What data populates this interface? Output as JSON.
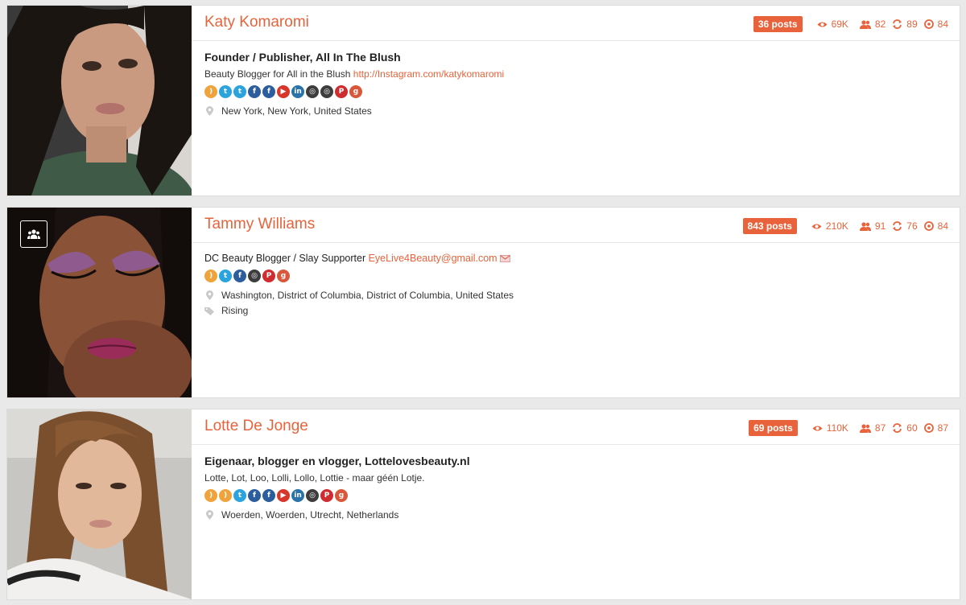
{
  "profiles": [
    {
      "name": "Katy Komaromi",
      "posts": "36 posts",
      "views": "69K",
      "followers": "82",
      "shares": "89",
      "score": "84",
      "title": "Founder / Publisher, All In The Blush",
      "bio": "Beauty Blogger for All in the Blush ",
      "bio_link": "http://Instagram.com/katykomaromi",
      "location": "New York, New York, United States",
      "socials": [
        "rss-icon",
        "twitter-icon",
        "twitter-icon",
        "facebook-icon",
        "facebook-icon",
        "youtube-icon",
        "linkedin-icon",
        "instagram-icon",
        "instagram-icon",
        "pinterest-icon",
        "google-plus-icon"
      ]
    },
    {
      "name": "Tammy Williams",
      "posts": "843 posts",
      "views": "210K",
      "followers": "91",
      "shares": "76",
      "score": "84",
      "title": "DC Beauty Blogger / Slay Supporter ",
      "title_link": "EyeLive4Beauty@gmail.com",
      "location": "Washington, District of Columbia, District of Columbia, United States",
      "tag": "Rising",
      "socials": [
        "rss-icon",
        "twitter-icon",
        "facebook-icon",
        "instagram-icon",
        "pinterest-icon",
        "google-plus-icon"
      ]
    },
    {
      "name": "Lotte De Jonge",
      "posts": "69 posts",
      "views": "110K",
      "followers": "87",
      "shares": "60",
      "score": "87",
      "title": "Eigenaar, blogger en vlogger, Lottelovesbeauty.nl",
      "bio": "Lotte, Lot, Loo, Lolli, Lollo, Lottie - maar géén Lotje.",
      "location": "Woerden, Woerden, Utrecht, Netherlands",
      "socials": [
        "rss-icon",
        "rss-icon",
        "twitter-icon",
        "facebook-icon",
        "facebook-icon",
        "youtube-icon",
        "linkedin-icon",
        "instagram-icon",
        "pinterest-icon",
        "google-plus-icon"
      ]
    }
  ],
  "colors": {
    "accent": "#e8633b"
  }
}
